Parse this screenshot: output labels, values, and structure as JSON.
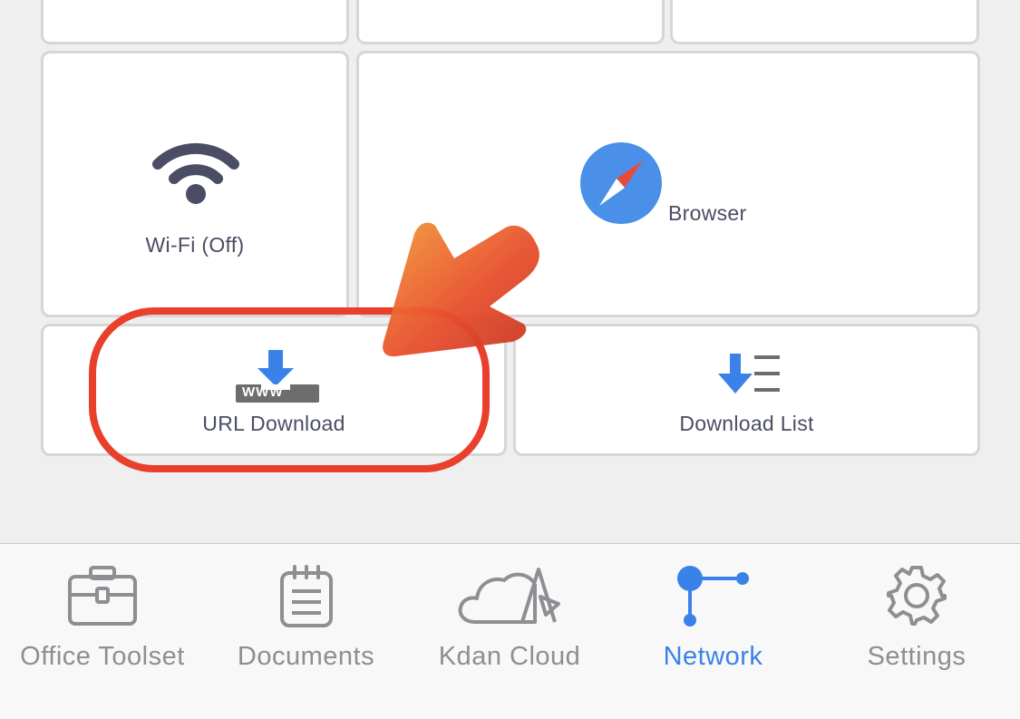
{
  "tiles": {
    "wifi": {
      "label": "Wi-Fi (Off)",
      "icon": "wifi-icon"
    },
    "browser": {
      "label": "Browser",
      "icon": "compass-icon"
    },
    "url_download": {
      "label": "URL Download",
      "icon": "url-download-icon",
      "icon_text": "WWW"
    },
    "download_list": {
      "label": "Download List",
      "icon": "download-list-icon"
    }
  },
  "tabbar": {
    "active": "Network",
    "items": [
      {
        "label": "Office Toolset",
        "icon": "toolbox-icon"
      },
      {
        "label": "Documents",
        "icon": "notepad-icon"
      },
      {
        "label": "Kdan Cloud",
        "icon": "cloud-icon"
      },
      {
        "label": "Network",
        "icon": "network-icon"
      },
      {
        "label": "Settings",
        "icon": "gear-icon"
      }
    ]
  },
  "colors": {
    "accent": "#3b82e8",
    "tab_inactive": "#8e8e93",
    "annotation": "#e8402a"
  }
}
